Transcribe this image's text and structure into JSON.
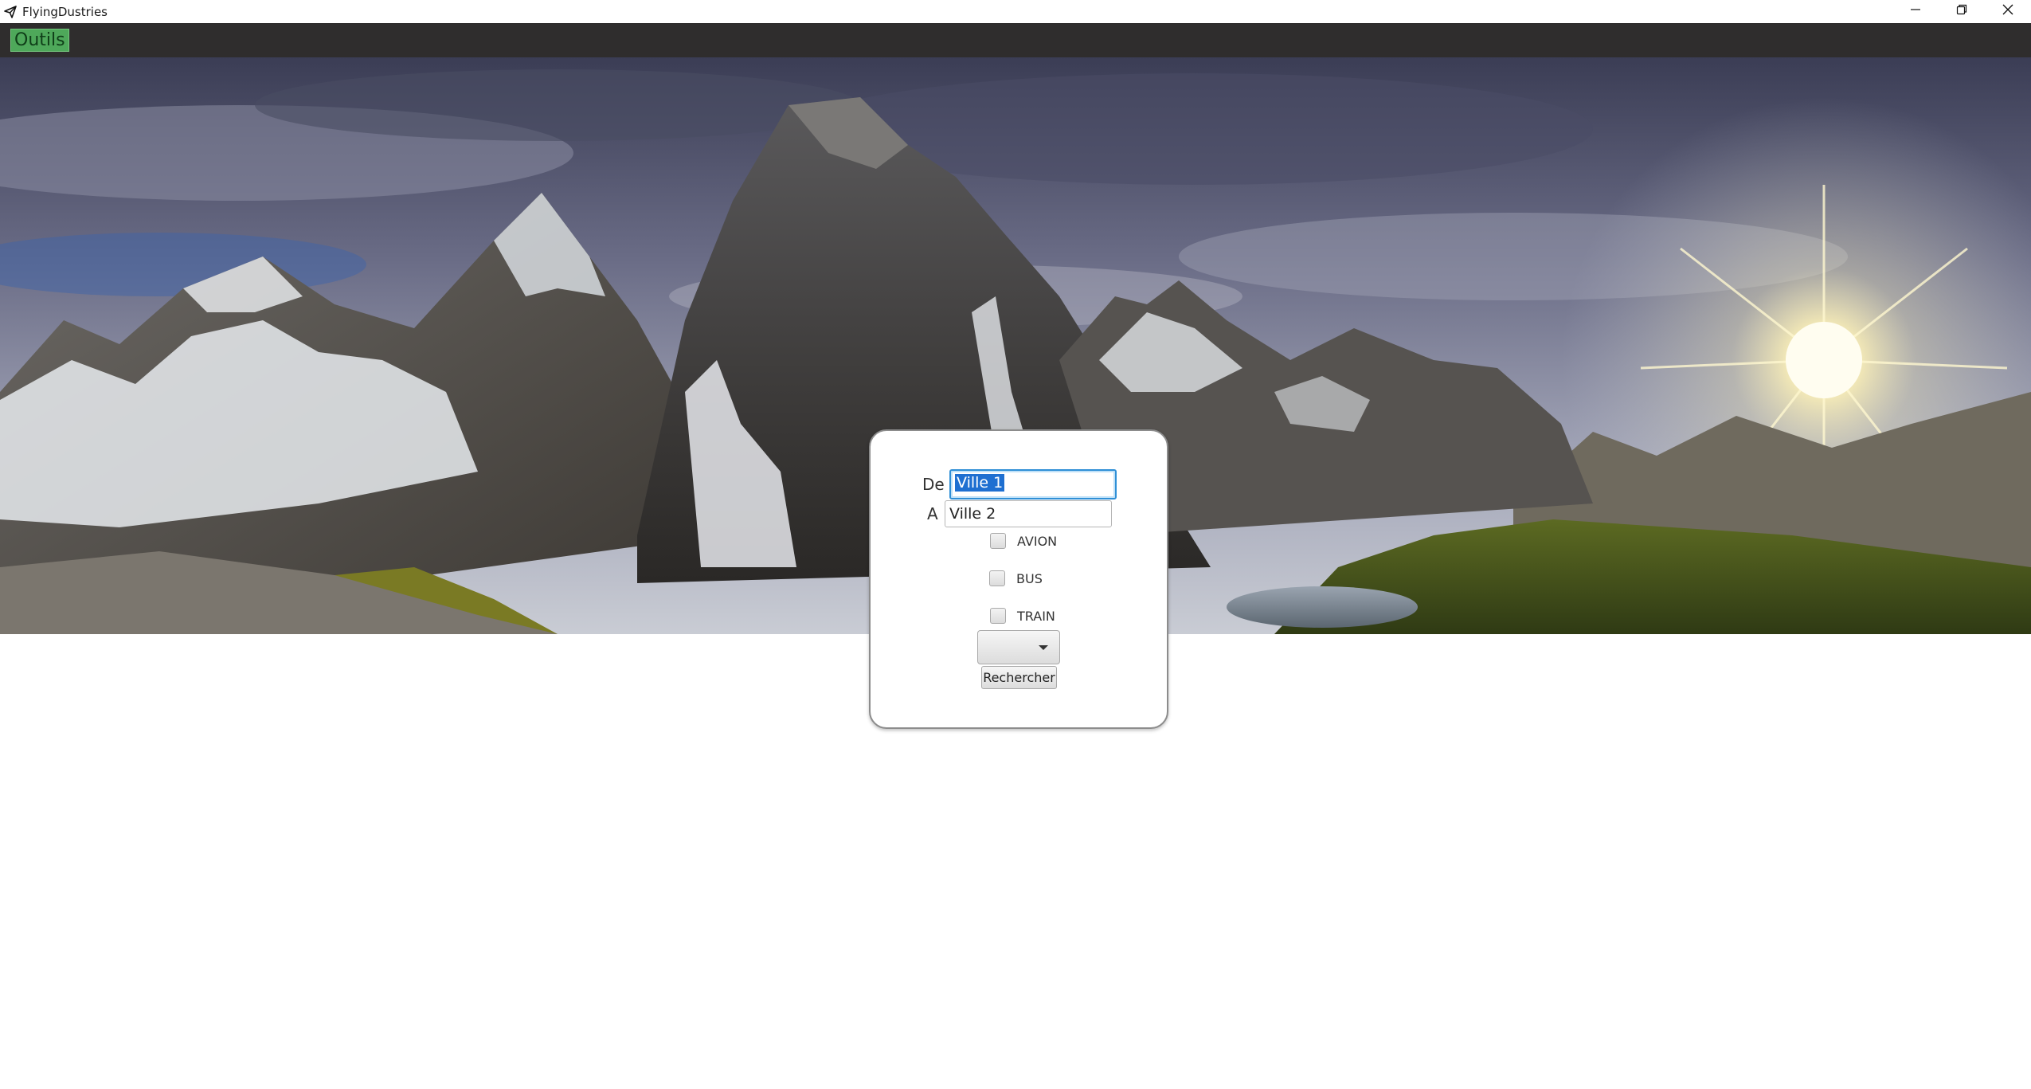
{
  "window": {
    "title": "FlyingDustries",
    "icons": {
      "app": "paper-plane-icon",
      "minimize": "minimize-icon",
      "restore": "restore-icon",
      "close": "close-icon"
    }
  },
  "menubar": {
    "items": [
      {
        "label": "Outils"
      }
    ],
    "colors": {
      "background": "#2f2d2d",
      "active_item": "#4ea85a"
    }
  },
  "search": {
    "from_label": "De :",
    "from_value": "Ville 1",
    "to_label": "A :",
    "to_value": "Ville 2",
    "modes": [
      {
        "label": "AVION",
        "checked": false
      },
      {
        "label": "BUS",
        "checked": false
      },
      {
        "label": "TRAIN",
        "checked": false
      }
    ],
    "dropdown_value": "",
    "submit_label": "Rechercher"
  },
  "colors": {
    "focus_ring": "#2f8fd6",
    "selection": "#1e6fd1"
  }
}
